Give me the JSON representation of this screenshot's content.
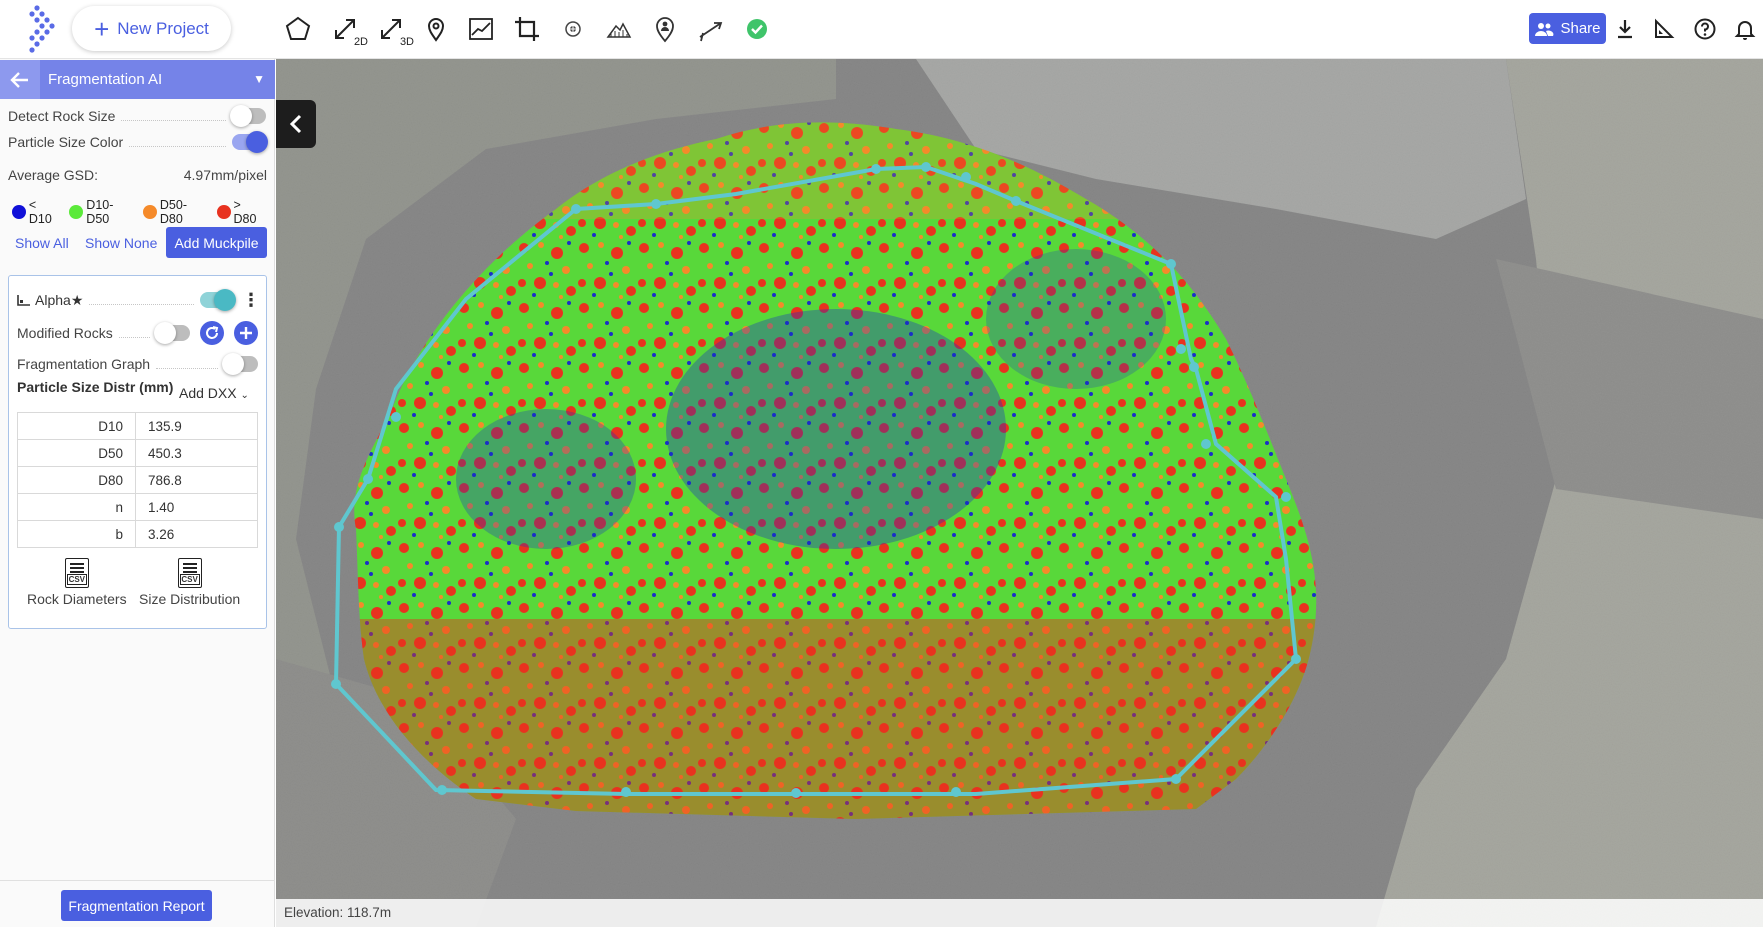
{
  "topbar": {
    "new_project_label": "New Project",
    "tools": [
      {
        "name": "polygon-tool",
        "icon": "pentagon-icon"
      },
      {
        "name": "measure-2d-tool",
        "icon": "diagonal-arrow-icon",
        "suffix": "2D"
      },
      {
        "name": "measure-3d-tool",
        "icon": "diagonal-arrow-icon",
        "suffix": "3D"
      },
      {
        "name": "location-tool",
        "icon": "map-pin-icon"
      },
      {
        "name": "profile-tool",
        "icon": "elevation-profile-icon"
      },
      {
        "name": "crop-tool",
        "icon": "crop-icon"
      },
      {
        "name": "target-tool",
        "icon": "target-icon"
      },
      {
        "name": "volume-tool",
        "icon": "stockpile-icon"
      },
      {
        "name": "annotate-tool",
        "icon": "person-pin-icon"
      },
      {
        "name": "drill-tool",
        "icon": "drill-icon"
      },
      {
        "name": "confirm-tool",
        "icon": "check-circle-icon"
      }
    ],
    "share_label": "Share",
    "colors": {
      "accent": "#4a5fe0",
      "check": "#3fc46a"
    }
  },
  "panel": {
    "title": "Fragmentation AI",
    "detect_rock_size": {
      "label": "Detect Rock Size",
      "on": false
    },
    "particle_size_color": {
      "label": "Particle Size Color",
      "on": true
    },
    "gsd": {
      "label": "Average GSD:",
      "value": "4.97mm/pixel"
    },
    "legend": [
      {
        "label": "< D10",
        "color": "#1010d8"
      },
      {
        "label": "D10-D50",
        "color": "#5bea3a"
      },
      {
        "label": "D50-D80",
        "color": "#f58a2a"
      },
      {
        "label": "> D80",
        "color": "#e8321f"
      }
    ],
    "show_all": "Show All",
    "show_none": "Show None",
    "add_muckpile": "Add Muckpile",
    "alpha": {
      "name": "Alpha",
      "star": "★",
      "visible": true,
      "modified_rocks": {
        "label": "Modified Rocks",
        "on": false
      },
      "fragmentation_graph": {
        "label": "Fragmentation Graph",
        "on": false
      },
      "psd_title": "Particle Size Distr (mm)",
      "add_dxx": "Add DXX",
      "table": [
        {
          "k": "D10",
          "v": "135.9"
        },
        {
          "k": "D50",
          "v": "450.3"
        },
        {
          "k": "D80",
          "v": "786.8"
        },
        {
          "k": "n",
          "v": "1.40"
        },
        {
          "k": "b",
          "v": "3.26"
        }
      ],
      "csv_file_label": "CSV",
      "rock_diameters": "Rock Diameters",
      "size_distribution": "Size Distribution"
    },
    "report_button": "Fragmentation Report"
  },
  "map": {
    "elevation": "Elevation: 118.7m",
    "muckpile_outline_color": "#5fc7cf"
  }
}
